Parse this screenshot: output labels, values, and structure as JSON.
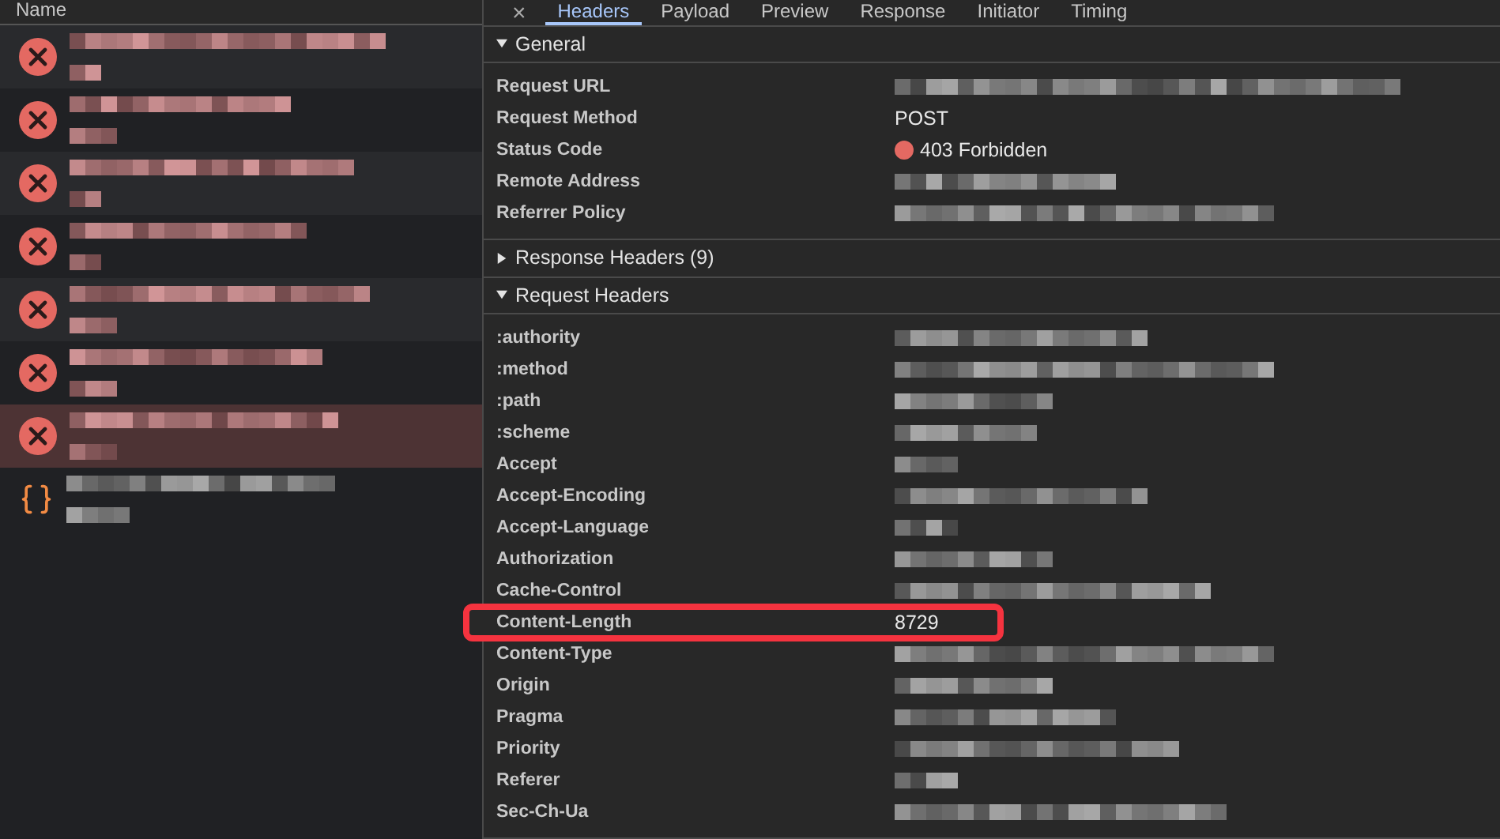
{
  "requests": {
    "header": "Name",
    "rows": [
      {
        "kind": "error",
        "selected": false
      },
      {
        "kind": "error",
        "selected": false
      },
      {
        "kind": "error",
        "selected": false
      },
      {
        "kind": "error",
        "selected": false
      },
      {
        "kind": "error",
        "selected": false
      },
      {
        "kind": "error",
        "selected": false
      },
      {
        "kind": "error",
        "selected": true
      },
      {
        "kind": "script",
        "selected": false
      }
    ]
  },
  "close": "×",
  "tabs": [
    {
      "label": "Headers",
      "selected": true
    },
    {
      "label": "Payload",
      "selected": false
    },
    {
      "label": "Preview",
      "selected": false
    },
    {
      "label": "Response",
      "selected": false
    },
    {
      "label": "Initiator",
      "selected": false
    },
    {
      "label": "Timing",
      "selected": false
    }
  ],
  "sections": [
    {
      "title": "General",
      "expanded": true,
      "rows": [
        {
          "label": "Request URL",
          "kind": "redacted"
        },
        {
          "label": "Request Method",
          "kind": "text",
          "value": "POST"
        },
        {
          "label": "Status Code",
          "kind": "status",
          "value": "403 Forbidden",
          "color": "#e46962"
        },
        {
          "label": "Remote Address",
          "kind": "redacted"
        },
        {
          "label": "Referrer Policy",
          "kind": "redacted"
        }
      ]
    },
    {
      "title": "Response Headers (9)",
      "expanded": false
    },
    {
      "title": "Request Headers",
      "expanded": true,
      "rows": [
        {
          "label": ":authority",
          "kind": "redacted"
        },
        {
          "label": ":method",
          "kind": "redacted"
        },
        {
          "label": ":path",
          "kind": "redacted"
        },
        {
          "label": ":scheme",
          "kind": "redacted"
        },
        {
          "label": "Accept",
          "kind": "redacted"
        },
        {
          "label": "Accept-Encoding",
          "kind": "redacted"
        },
        {
          "label": "Accept-Language",
          "kind": "redacted"
        },
        {
          "label": "Authorization",
          "kind": "redacted"
        },
        {
          "label": "Cache-Control",
          "kind": "redacted"
        },
        {
          "label": "Content-Length",
          "kind": "text",
          "value": "8729",
          "highlighted": true
        },
        {
          "label": "Content-Type",
          "kind": "redacted"
        },
        {
          "label": "Origin",
          "kind": "redacted"
        },
        {
          "label": "Pragma",
          "kind": "redacted"
        },
        {
          "label": "Priority",
          "kind": "redacted"
        },
        {
          "label": "Referer",
          "kind": "redacted"
        },
        {
          "label": "Sec-Ch-Ua",
          "kind": "redacted"
        }
      ]
    }
  ]
}
